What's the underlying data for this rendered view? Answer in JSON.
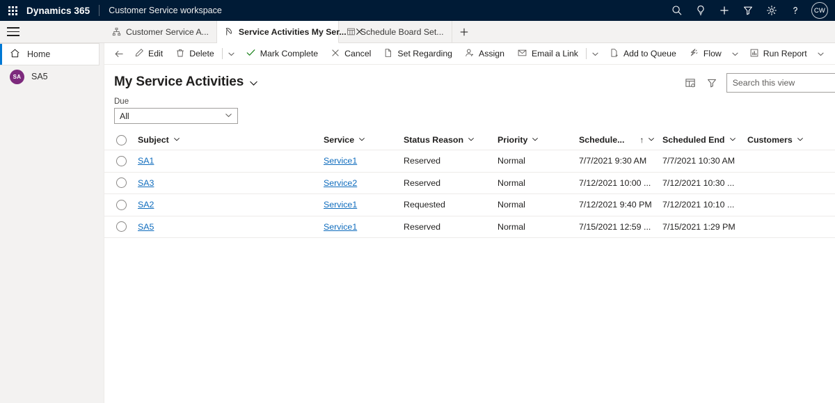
{
  "topbar": {
    "waffle_label": "app-launcher",
    "brand": "Dynamics 365",
    "app_name": "Customer Service workspace",
    "icons": [
      "search-icon",
      "lightbulb-icon",
      "plus-icon",
      "filter-icon",
      "gear-icon",
      "help-icon"
    ],
    "avatar_initials": "CW",
    "bg_color": "#001b36"
  },
  "tabs": [
    {
      "label": "Customer Service A...",
      "icon": "sitemap-icon",
      "active": false,
      "closable": false
    },
    {
      "label": "Service Activities My Ser...",
      "icon": "service-activity-icon",
      "active": true,
      "closable": true
    },
    {
      "label": "Schedule Board Set...",
      "icon": "board-icon",
      "active": false,
      "closable": false
    }
  ],
  "tab_add_label": "+",
  "sidebar": {
    "items": [
      {
        "label": "Home",
        "icon": "home-icon",
        "selected": true
      },
      {
        "label": "SA5",
        "icon": "avatar",
        "avatar_initials": "SA",
        "avatar_color": "#7d2a7d",
        "selected": false
      }
    ]
  },
  "commandbar": {
    "back_label": "back-arrow",
    "commands": [
      {
        "label": "Edit",
        "icon": "pencil-icon"
      },
      {
        "label": "Delete",
        "icon": "trash-icon"
      },
      {
        "label": "Mark Complete",
        "icon": "checkmark-icon"
      },
      {
        "label": "Cancel",
        "icon": "cancel-x-icon"
      },
      {
        "label": "Set Regarding",
        "icon": "document-icon"
      },
      {
        "label": "Assign",
        "icon": "person-icon"
      },
      {
        "label": "Email a Link",
        "icon": "email-link-icon"
      },
      {
        "label": "Add to Queue",
        "icon": "queue-icon"
      },
      {
        "label": "Flow",
        "icon": "flow-icon"
      },
      {
        "label": "Run Report",
        "icon": "report-icon"
      }
    ],
    "overflow_label": "more-commands"
  },
  "view": {
    "title": "My Service Activities",
    "edit_columns_icon": "edit-columns-icon",
    "filter_icon": "filter-icon",
    "search_placeholder": "Search this view",
    "search_value": ""
  },
  "due_filter": {
    "label": "Due",
    "value": "All",
    "options": [
      "All"
    ]
  },
  "grid": {
    "columns": [
      {
        "key": "subject",
        "label": "Subject",
        "sorted": false
      },
      {
        "key": "service",
        "label": "Service",
        "sorted": false
      },
      {
        "key": "status",
        "label": "Status Reason",
        "sorted": false
      },
      {
        "key": "priority",
        "label": "Priority",
        "sorted": false
      },
      {
        "key": "start",
        "label": "Schedule...",
        "sorted": true,
        "sort_dir": "asc",
        "sort_glyph": "↑"
      },
      {
        "key": "end",
        "label": "Scheduled End",
        "sorted": false
      },
      {
        "key": "customers",
        "label": "Customers",
        "sorted": false
      }
    ],
    "rows": [
      {
        "subject": "SA1",
        "service": "Service1",
        "status": "Reserved",
        "priority": "Normal",
        "start": "7/7/2021 9:30 AM",
        "end": "7/7/2021 10:30 AM",
        "customers": ""
      },
      {
        "subject": "SA3",
        "service": "Service2",
        "status": "Reserved",
        "priority": "Normal",
        "start": "7/12/2021 10:00 ...",
        "end": "7/12/2021 10:30 ...",
        "customers": ""
      },
      {
        "subject": "SA2",
        "service": "Service1",
        "status": "Requested",
        "priority": "Normal",
        "start": "7/12/2021 9:40 PM",
        "end": "7/12/2021 10:10 ...",
        "customers": ""
      },
      {
        "subject": "SA5",
        "service": "Service1",
        "status": "Reserved",
        "priority": "Normal",
        "start": "7/15/2021 12:59 ...",
        "end": "7/15/2021 1:29 PM",
        "customers": ""
      }
    ]
  },
  "colors": {
    "link": "#0f6cbd",
    "accent": "#0078d4",
    "header_navy": "#001b36",
    "check_green": "#107c10"
  }
}
